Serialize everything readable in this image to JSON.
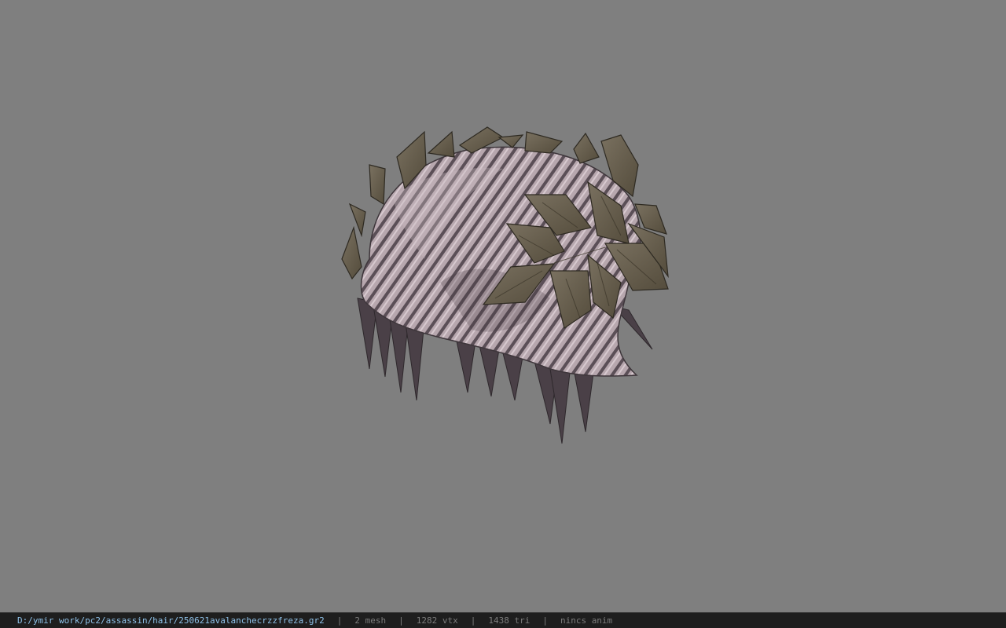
{
  "status_bar": {
    "file_path": "D:/ymir work/pc2/assassin/hair/250621avalanchecrzzfreza.gr2",
    "separator": "|",
    "mesh_count": "2 mesh",
    "vertex_count": "1282 vtx",
    "triangle_count": "1438 tri",
    "animation": "nincs anim"
  },
  "colors": {
    "viewport_background": "#7f7f7f",
    "status_background": "#1e1e1e",
    "path_text": "#8ec1e8",
    "stat_text": "#7c7c7c",
    "leaf": "#6b6250",
    "hair": "#b8a8b0"
  }
}
